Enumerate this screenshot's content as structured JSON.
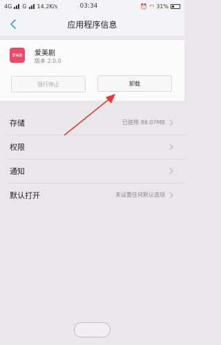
{
  "status_bar": {
    "network_1": "4G",
    "network_2": "G",
    "speed": "14.2K/s",
    "time": "03:34",
    "battery": "31%"
  },
  "app_bar": {
    "title": "应用程序信息"
  },
  "app": {
    "icon_text": "爱美剧",
    "name": "爱美剧",
    "version": "版本 2.0.0"
  },
  "buttons": {
    "force_stop": "强行停止",
    "uninstall": "卸载"
  },
  "list": [
    {
      "label": "存储",
      "value": "已使用 88.07MB"
    },
    {
      "label": "权限",
      "value": ""
    },
    {
      "label": "通知",
      "value": ""
    },
    {
      "label": "默认打开",
      "value": "未设置任何默认选项"
    }
  ],
  "colors": {
    "accent": "#2aa6e0",
    "app_icon": "#e94a68",
    "arrow": "#e53935"
  }
}
